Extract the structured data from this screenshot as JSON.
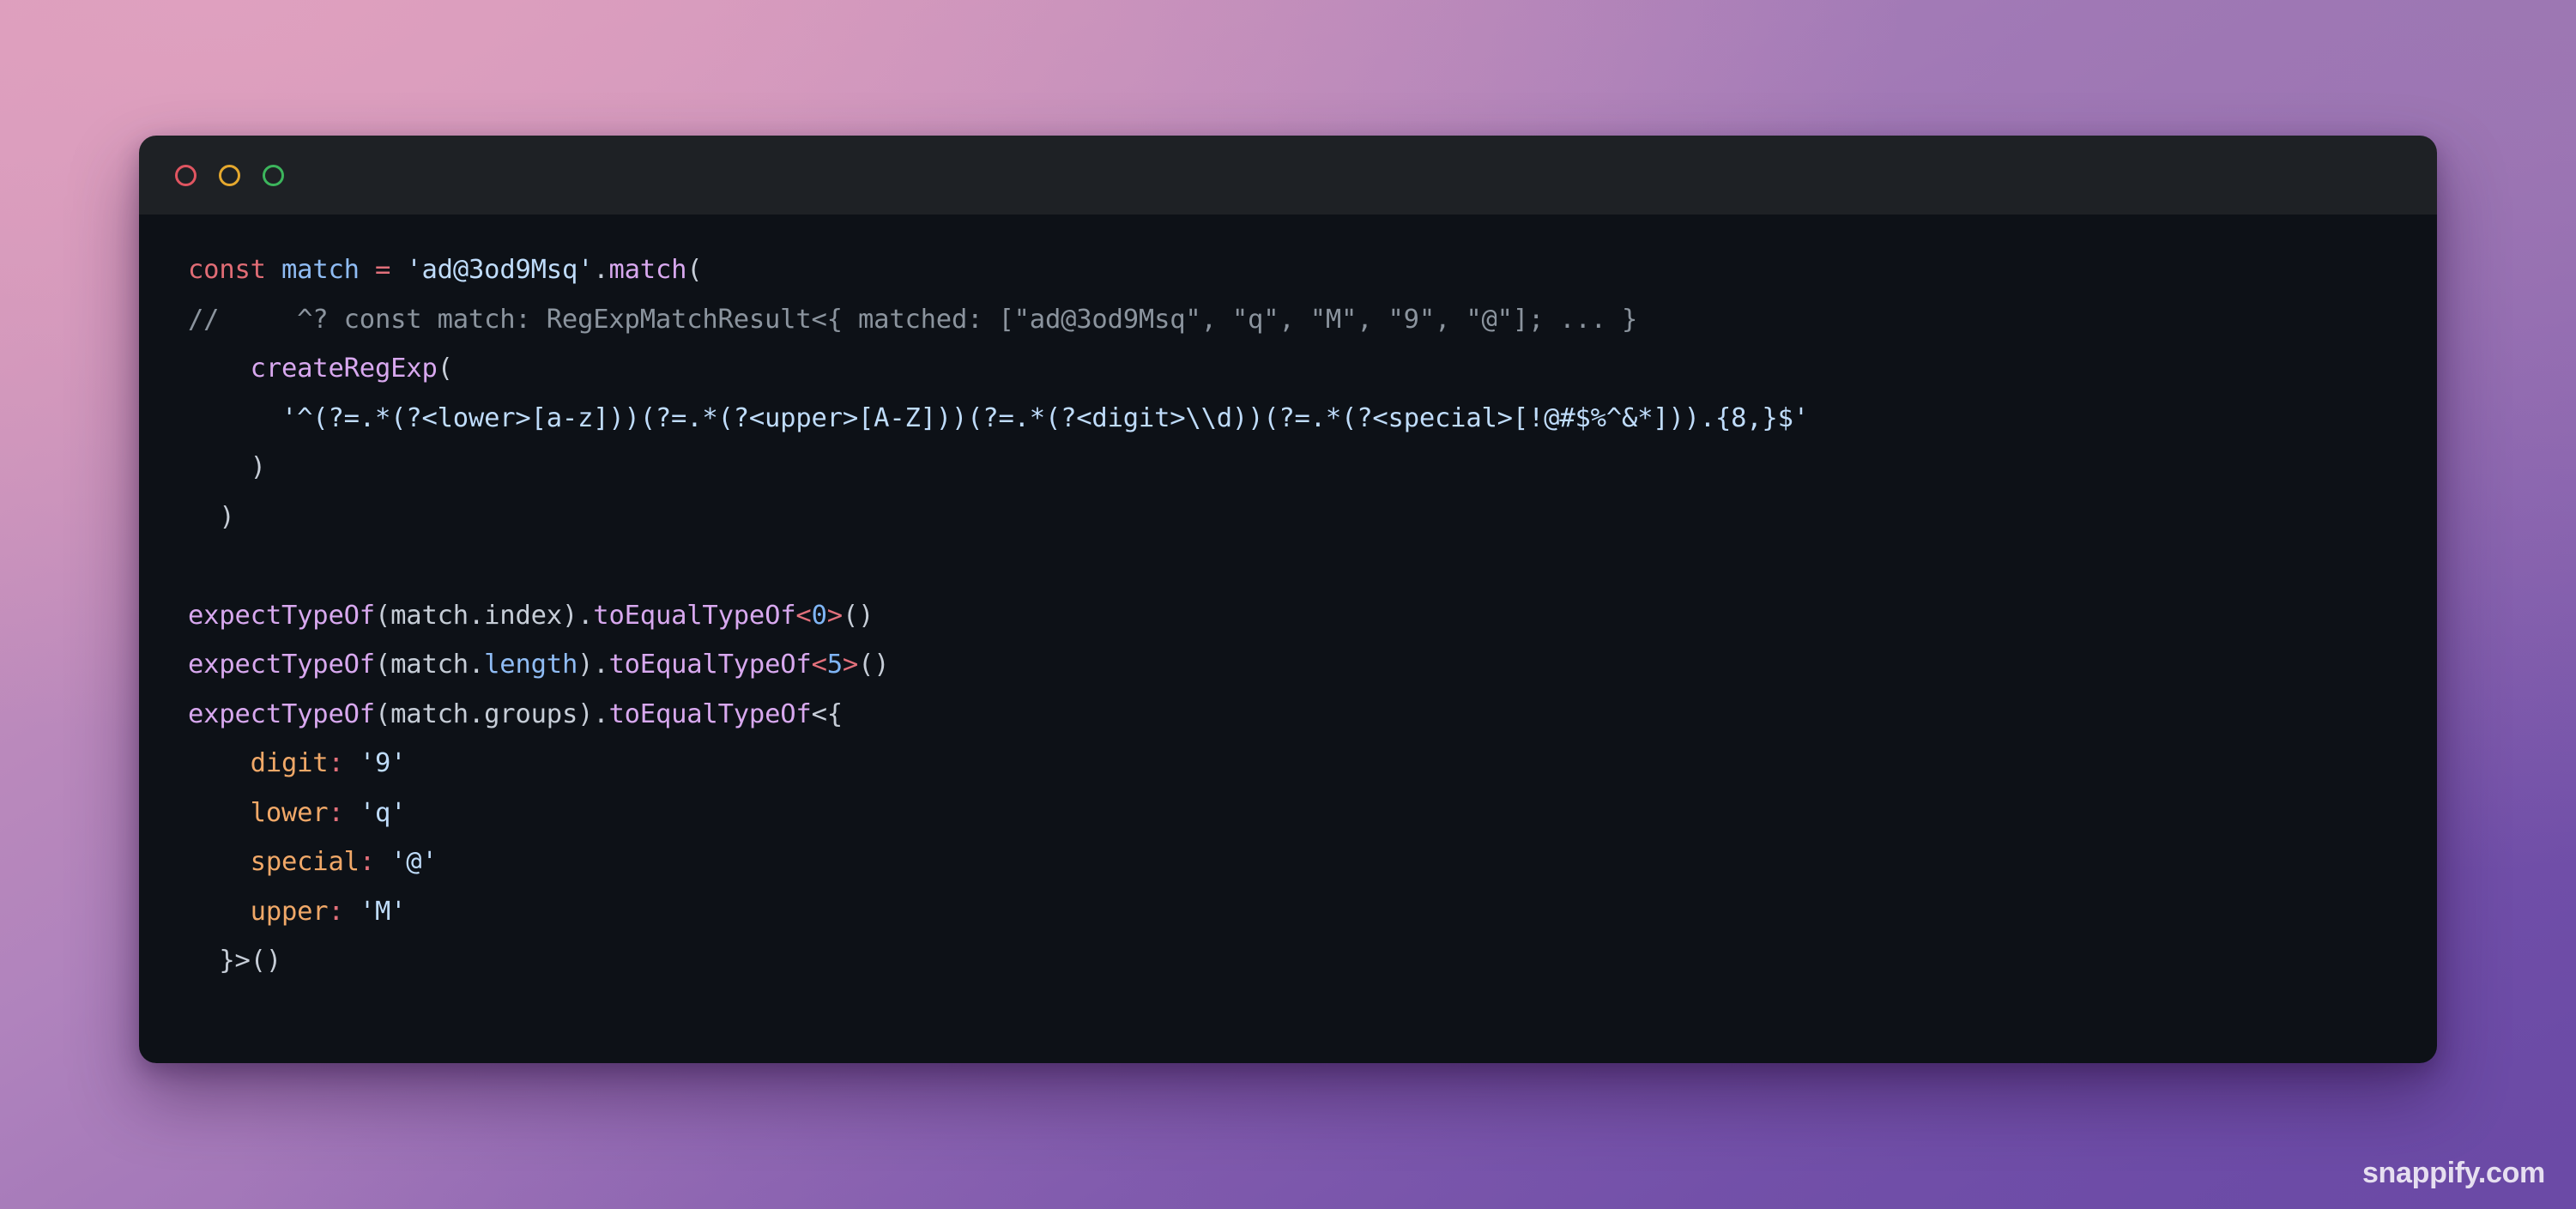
{
  "window": {
    "titlebar": {
      "buttons": [
        {
          "name": "close",
          "color": "#e05561"
        },
        {
          "name": "minimize",
          "color": "#e5a82e"
        },
        {
          "name": "maximize",
          "color": "#3cb55c"
        }
      ]
    },
    "background": "#0d1117",
    "titlebar_background": "#1e2125"
  },
  "code": {
    "language": "typescript",
    "lines": [
      {
        "n": 1,
        "tokens": [
          {
            "t": "const",
            "c": "kw"
          },
          {
            "t": " ",
            "c": "punc"
          },
          {
            "t": "match",
            "c": "var"
          },
          {
            "t": " ",
            "c": "punc"
          },
          {
            "t": "=",
            "c": "op"
          },
          {
            "t": " ",
            "c": "punc"
          },
          {
            "t": "'ad@3od9Msq'",
            "c": "str"
          },
          {
            "t": ".",
            "c": "punc"
          },
          {
            "t": "match",
            "c": "fn"
          },
          {
            "t": "(",
            "c": "punc"
          }
        ]
      },
      {
        "n": 2,
        "tokens": [
          {
            "t": "//     ^? const match: RegExpMatchResult<{ matched: [\"ad@3od9Msq\", \"q\", \"M\", \"9\", \"@\"]; ... }",
            "c": "com"
          }
        ]
      },
      {
        "n": 3,
        "tokens": [
          {
            "t": "    ",
            "c": "punc"
          },
          {
            "t": "createRegExp",
            "c": "fn"
          },
          {
            "t": "(",
            "c": "punc"
          }
        ]
      },
      {
        "n": 4,
        "tokens": [
          {
            "t": "      ",
            "c": "punc"
          },
          {
            "t": "'^(?=.*(?<lower>[a-z]))(?=.*(?<upper>[A-Z]))(?=.*(?<digit>\\\\d))(?=.*(?<special>[!@#$%^&*])).{8,}$'",
            "c": "regex"
          }
        ]
      },
      {
        "n": 5,
        "tokens": [
          {
            "t": "    )",
            "c": "punc"
          }
        ]
      },
      {
        "n": 6,
        "tokens": [
          {
            "t": "  )",
            "c": "punc"
          }
        ]
      },
      {
        "n": 7,
        "tokens": []
      },
      {
        "n": 8,
        "tokens": [
          {
            "t": "expectTypeOf",
            "c": "fn"
          },
          {
            "t": "(",
            "c": "punc"
          },
          {
            "t": "match",
            "c": "prop"
          },
          {
            "t": ".",
            "c": "punc"
          },
          {
            "t": "index",
            "c": "prop"
          },
          {
            "t": ")",
            "c": "punc"
          },
          {
            "t": ".",
            "c": "punc"
          },
          {
            "t": "toEqualTypeOf",
            "c": "fn"
          },
          {
            "t": "<",
            "c": "op"
          },
          {
            "t": "0",
            "c": "num"
          },
          {
            "t": ">",
            "c": "op"
          },
          {
            "t": "()",
            "c": "punc"
          }
        ]
      },
      {
        "n": 9,
        "tokens": [
          {
            "t": "expectTypeOf",
            "c": "fn"
          },
          {
            "t": "(",
            "c": "punc"
          },
          {
            "t": "match",
            "c": "prop"
          },
          {
            "t": ".",
            "c": "punc"
          },
          {
            "t": "length",
            "c": "var"
          },
          {
            "t": ")",
            "c": "punc"
          },
          {
            "t": ".",
            "c": "punc"
          },
          {
            "t": "toEqualTypeOf",
            "c": "fn"
          },
          {
            "t": "<",
            "c": "op"
          },
          {
            "t": "5",
            "c": "num"
          },
          {
            "t": ">",
            "c": "op"
          },
          {
            "t": "()",
            "c": "punc"
          }
        ]
      },
      {
        "n": 10,
        "tokens": [
          {
            "t": "expectTypeOf",
            "c": "fn"
          },
          {
            "t": "(",
            "c": "punc"
          },
          {
            "t": "match",
            "c": "prop"
          },
          {
            "t": ".",
            "c": "punc"
          },
          {
            "t": "groups",
            "c": "prop"
          },
          {
            "t": ")",
            "c": "punc"
          },
          {
            "t": ".",
            "c": "punc"
          },
          {
            "t": "toEqualTypeOf",
            "c": "fn"
          },
          {
            "t": "<{",
            "c": "punc"
          }
        ]
      },
      {
        "n": 11,
        "tokens": [
          {
            "t": "    ",
            "c": "punc"
          },
          {
            "t": "digit",
            "c": "key"
          },
          {
            "t": ":",
            "c": "op"
          },
          {
            "t": " ",
            "c": "punc"
          },
          {
            "t": "'9'",
            "c": "str"
          }
        ]
      },
      {
        "n": 12,
        "tokens": [
          {
            "t": "    ",
            "c": "punc"
          },
          {
            "t": "lower",
            "c": "key"
          },
          {
            "t": ":",
            "c": "op"
          },
          {
            "t": " ",
            "c": "punc"
          },
          {
            "t": "'q'",
            "c": "str"
          }
        ]
      },
      {
        "n": 13,
        "tokens": [
          {
            "t": "    ",
            "c": "punc"
          },
          {
            "t": "special",
            "c": "key"
          },
          {
            "t": ":",
            "c": "op"
          },
          {
            "t": " ",
            "c": "punc"
          },
          {
            "t": "'@'",
            "c": "str"
          }
        ]
      },
      {
        "n": 14,
        "tokens": [
          {
            "t": "    ",
            "c": "punc"
          },
          {
            "t": "upper",
            "c": "key"
          },
          {
            "t": ":",
            "c": "op"
          },
          {
            "t": " ",
            "c": "punc"
          },
          {
            "t": "'M'",
            "c": "str"
          }
        ]
      },
      {
        "n": 15,
        "tokens": [
          {
            "t": "  }>()",
            "c": "punc"
          }
        ]
      }
    ]
  },
  "watermark": {
    "text": "snappify.com"
  }
}
